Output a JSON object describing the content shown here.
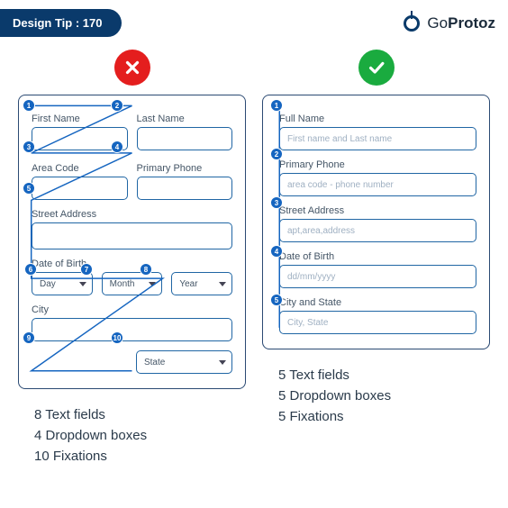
{
  "header": {
    "badge": "Design Tip : 170",
    "brand_part1": "Go",
    "brand_part2": "Protoz"
  },
  "bad": {
    "labels": {
      "firstName": "First Name",
      "lastName": "Last Name",
      "areaCode": "Area Code",
      "primaryPhone": "Primary Phone",
      "streetAddress": "Street Address",
      "dob": "Date of Birth",
      "city": "City"
    },
    "dob": {
      "day": "Day",
      "month": "Month",
      "year": "Year"
    },
    "state": "State",
    "fixations": [
      "1",
      "2",
      "3",
      "4",
      "5",
      "6",
      "7",
      "8",
      "9",
      "10"
    ],
    "stats": {
      "l1": "8 Text fields",
      "l2": "4 Dropdown boxes",
      "l3": "10 Fixations"
    }
  },
  "good": {
    "fields": {
      "fullName": {
        "label": "Full Name",
        "placeholder": "First name and  Last name"
      },
      "phone": {
        "label": "Primary Phone",
        "placeholder": "area code - phone number"
      },
      "street": {
        "label": "Street Address",
        "placeholder": "apt,area,address"
      },
      "dob": {
        "label": "Date of Birth",
        "placeholder": "dd/mm/yyyy"
      },
      "cityState": {
        "label": "City and State",
        "placeholder": "City, State"
      }
    },
    "fixations": [
      "1",
      "2",
      "3",
      "4",
      "5"
    ],
    "stats": {
      "l1": "5 Text fields",
      "l2": "5 Dropdown boxes",
      "l3": "5 Fixations"
    }
  },
  "colors": {
    "badge": "#0a3a6b",
    "dot": "#1565c0",
    "good": "#1aab3f",
    "bad": "#e41e1e",
    "field": "#2066a4"
  }
}
